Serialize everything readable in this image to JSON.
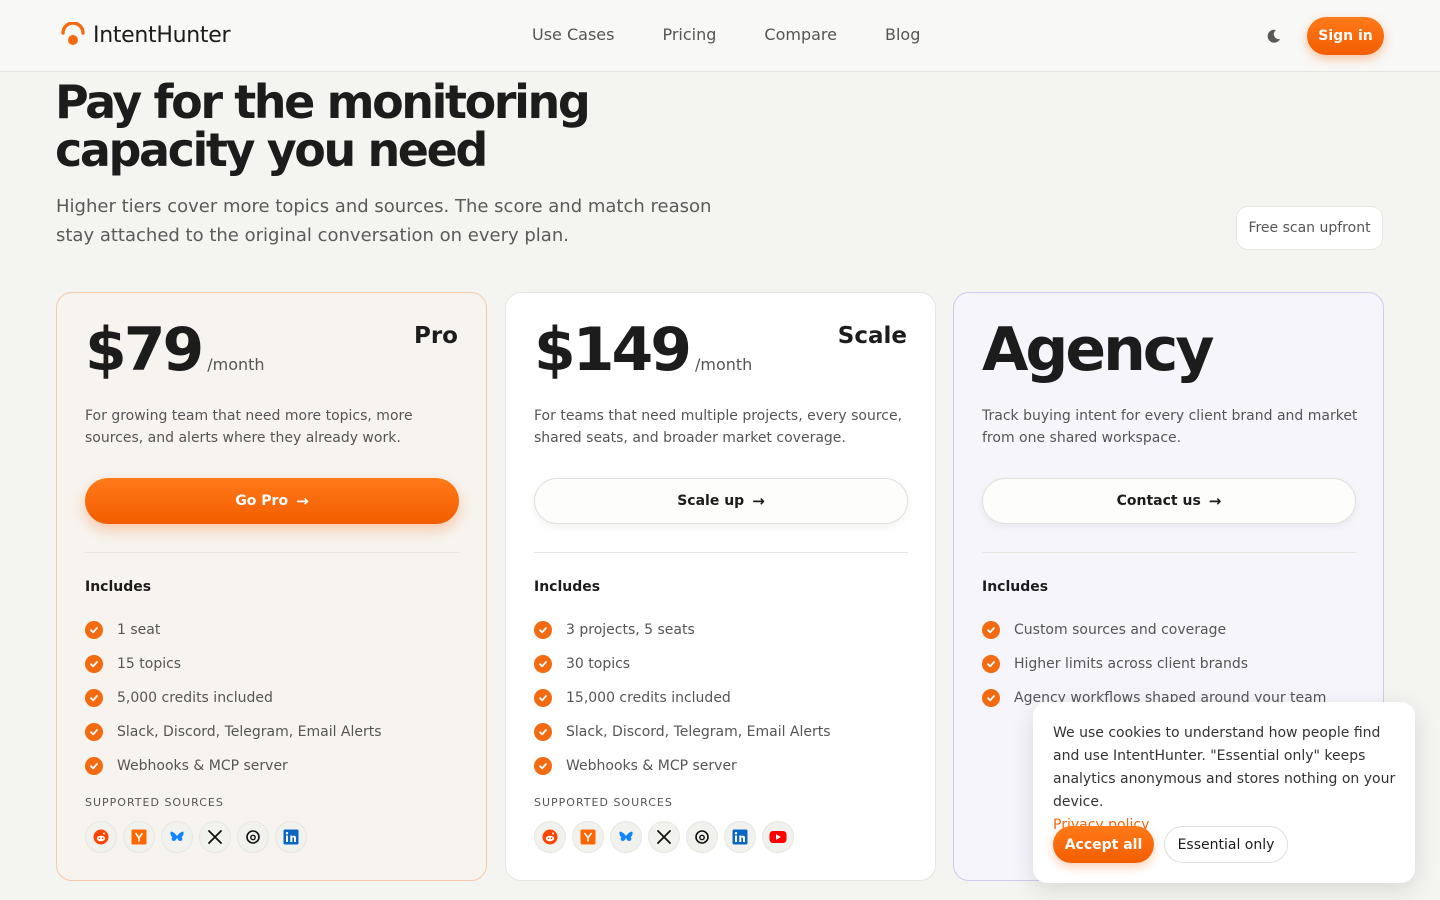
{
  "header": {
    "brand": "IntentHunter",
    "nav": [
      "Use Cases",
      "Pricing",
      "Compare",
      "Blog"
    ],
    "signin_label": "Sign in",
    "accent": "#f36a10"
  },
  "hero": {
    "title": "Pay for the monitoring capacity you need",
    "subtitle": "Higher tiers cover more topics and sources. The score and match reason stay attached to the original conversation on every plan.",
    "badge": "Free scan upfront"
  },
  "plans": [
    {
      "price": "$79",
      "period": "/month",
      "tier": "Pro",
      "description": "For growing team that need more topics, more sources, and alerts where they already work.",
      "cta": "Go Pro",
      "includes_label": "Includes",
      "features": [
        "1 seat",
        "15 topics",
        "5,000 credits included",
        "Slack, Discord, Telegram, Email Alerts",
        "Webhooks & MCP server"
      ],
      "sources_label": "SUPPORTED SOURCES",
      "sources": [
        "reddit-icon",
        "hacker-news-icon",
        "bluesky-icon",
        "x-icon",
        "threads-icon",
        "linkedin-icon"
      ]
    },
    {
      "price": "$149",
      "period": "/month",
      "tier": "Scale",
      "description": "For teams that need multiple projects, every source, shared seats, and broader market coverage.",
      "cta": "Scale up",
      "includes_label": "Includes",
      "features": [
        "3 projects, 5 seats",
        "30 topics",
        "15,000 credits included",
        "Slack, Discord, Telegram, Email Alerts",
        "Webhooks & MCP server"
      ],
      "sources_label": "SUPPORTED SOURCES",
      "sources": [
        "reddit-icon",
        "hacker-news-icon",
        "bluesky-icon",
        "x-icon",
        "threads-icon",
        "linkedin-icon",
        "youtube-icon"
      ]
    },
    {
      "price": "Agency",
      "description": "Track buying intent for every client brand and market from one shared workspace.",
      "cta": "Contact us",
      "includes_label": "Includes",
      "features": [
        "Custom sources and coverage",
        "Higher limits across client brands",
        "Agency workflows shaped around your team"
      ]
    }
  ],
  "cookie": {
    "text": "We use cookies to understand how people find and use IntentHunter. \"Essential only\" keeps analytics anonymous and stores nothing on your device.",
    "link": "Privacy policy",
    "accept": "Accept all",
    "essential": "Essential only"
  }
}
